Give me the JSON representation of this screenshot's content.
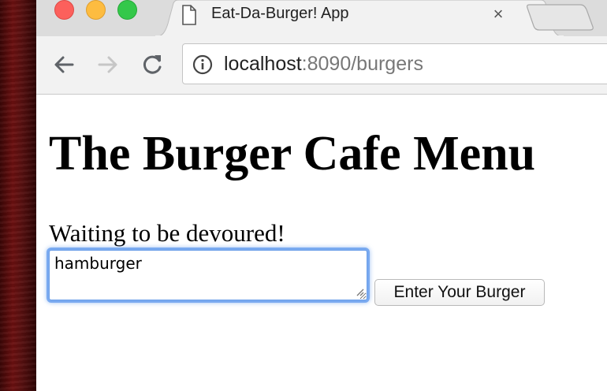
{
  "browser": {
    "tab": {
      "title": "Eat-Da-Burger! App",
      "close_glyph": "×",
      "icon": "document-icon"
    },
    "address_bar": {
      "host": "localhost",
      "rest": ":8090/burgers",
      "icon": "info-icon"
    },
    "nav_icons": [
      "back-arrow-icon",
      "forward-arrow-icon",
      "reload-icon"
    ]
  },
  "page": {
    "heading": "The Burger Cafe Menu",
    "waiting_label": "Waiting to be devoured!",
    "burger_input": {
      "value": "hamburger"
    },
    "submit_label": "Enter Your Burger"
  },
  "colors": {
    "close": "#fc605c",
    "minimize": "#fdbc40",
    "maximize": "#34c84a",
    "focus_ring": "#7aaaf0",
    "desktop": "#6b1010"
  }
}
